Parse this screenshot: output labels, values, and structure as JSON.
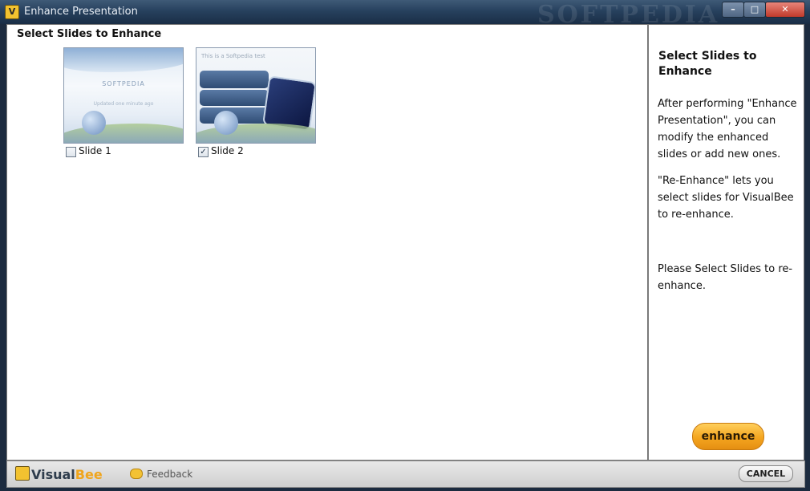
{
  "window": {
    "title": "Enhance Presentation",
    "watermark": "SOFTPEDIA",
    "controls": {
      "minimize": "–",
      "maximize": "□",
      "close": "✕"
    }
  },
  "main": {
    "heading": "Select Slides to Enhance",
    "slides": [
      {
        "label": "Slide 1",
        "checked": false,
        "thumb_title": "SOFTPEDIA",
        "thumb_subtitle": "Updated one minute ago"
      },
      {
        "label": "Slide 2",
        "checked": true,
        "thumb_title": "This is a Softpedia test"
      }
    ]
  },
  "side": {
    "title": "Select Slides to Enhance",
    "paragraphs": [
      "After performing \"Enhance Presentation\", you can modify the enhanced slides or add new ones.",
      "\"Re-Enhance\" lets you select slides for VisualBee to re-enhance.",
      "Please Select Slides to re-enhance."
    ],
    "enhance_label": "enhance"
  },
  "footer": {
    "logo_left": "Visual",
    "logo_right": "Bee",
    "feedback_label": "Feedback",
    "cancel_label": "CANCEL"
  }
}
